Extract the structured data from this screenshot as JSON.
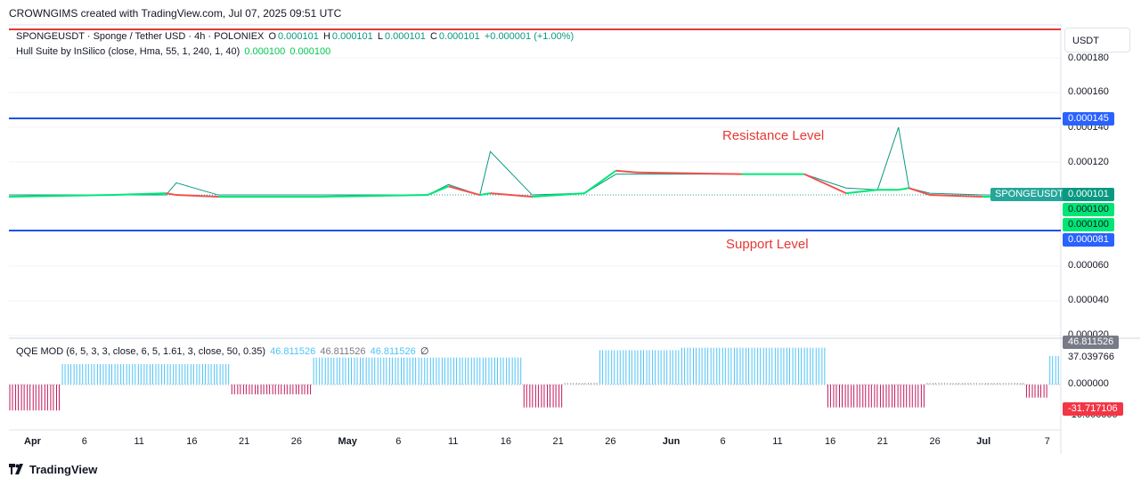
{
  "header": {
    "text": "CROWNGIMS created with TradingView.com, Jul 07, 2025 09:51 UTC"
  },
  "legend": {
    "symbol": "SPONGEUSDT · Sponge / Tether USD · 4h · POLONIEX",
    "o_label": "O",
    "o_value": "0.000101",
    "h_label": "H",
    "h_value": "0.000101",
    "l_label": "L",
    "l_value": "0.000101",
    "c_label": "C",
    "c_value": "0.000101",
    "change": "+0.000001 (+1.00%)",
    "hull_name": "Hull Suite by InSilico (close, Hma, 55, 1, 240, 1, 40)",
    "hull_v1": "0.000100",
    "hull_v2": "0.000100",
    "qqe_name": "QQE MOD (6, 5, 3, 3, close, 6, 5, 1.61, 3, close, 50, 0.35)",
    "qqe_v1": "46.811526",
    "qqe_v2": "46.811526",
    "qqe_v3": "46.811526",
    "qqe_v4": "∅"
  },
  "axis": {
    "unit": "USDT",
    "price_ticks": [
      "0.000180",
      "0.000160",
      "0.000140",
      "0.000120",
      "0.000060",
      "0.000040",
      "0.000020"
    ],
    "price_tick_values": [
      0.00018,
      0.00016,
      0.00014,
      0.00012,
      6e-05,
      4e-05,
      2e-05
    ],
    "qqe_ticks": [
      "37.039766",
      "0.000000",
      "-16.000000"
    ],
    "qqe_tick_values": [
      37.039766,
      0,
      -16
    ]
  },
  "tags": {
    "resistance": "0.000145",
    "last_price": "0.000101",
    "symbol_tag": "SPONGEUSDT",
    "hull_1": "0.000100",
    "hull_2": "0.000100",
    "support": "0.000081",
    "qqe_top": "46.811526",
    "qqe_bottom": "-31.717106"
  },
  "annotations": {
    "resistance": "Resistance Level",
    "support": "Support Level"
  },
  "x_axis": {
    "labels": [
      "Apr",
      "6",
      "11",
      "16",
      "21",
      "26",
      "May",
      "6",
      "11",
      "16",
      "21",
      "26",
      "Jun",
      "6",
      "11",
      "16",
      "21",
      "26",
      "Jul",
      "7"
    ],
    "day_index": [
      0,
      5,
      10,
      15,
      20,
      25,
      30,
      35,
      40,
      45,
      50,
      55,
      61,
      66,
      71,
      76,
      81,
      86,
      91,
      97
    ]
  },
  "footer": {
    "brand": "TradingView"
  },
  "colors": {
    "resistance_line": "#1e53e5",
    "support_line": "#1e53e5",
    "top_red": "#e53935",
    "hull_up": "#00e676",
    "hull_down": "#ef5350",
    "qqe_blue": "#4fc3f7",
    "qqe_magenta": "#c2185b",
    "qqe_grey": "#9e9e9e",
    "price_teal": "#089981"
  },
  "chart_data": [
    {
      "type": "line",
      "title": "SPONGEUSDT · Sponge / Tether USD · 4h · POLONIEX",
      "ylabel": "USDT",
      "ylim": [
        2e-05,
        0.00019
      ],
      "x": [
        0,
        10,
        15,
        16,
        20,
        30,
        40,
        42,
        45,
        46,
        50,
        55,
        58,
        60,
        70,
        76,
        80,
        83,
        85,
        86,
        88,
        93,
        94
      ],
      "series": [
        {
          "name": "SPONGEUSDT",
          "values": [
            0.000101,
            0.000101,
            0.000101,
            0.000108,
            0.000101,
            0.000101,
            0.000101,
            0.000107,
            0.000101,
            0.000126,
            0.000101,
            0.000102,
            0.000113,
            0.000113,
            0.000113,
            0.000113,
            0.000105,
            0.000104,
            0.00014,
            0.000105,
            0.000102,
            0.000101,
            0.000101
          ]
        },
        {
          "name": "Hull Suite",
          "values": [
            0.0001,
            0.000101,
            0.000102,
            0.000101,
            0.0001,
            0.0001,
            0.000101,
            0.000106,
            0.000101,
            0.000102,
            0.0001,
            0.000102,
            0.000115,
            0.000114,
            0.000113,
            0.000113,
            0.000102,
            0.000104,
            0.000104,
            0.000105,
            0.000101,
            0.0001,
            0.0001
          ]
        }
      ],
      "hlines": [
        {
          "name": "Resistance Level",
          "value": 0.000145
        },
        {
          "name": "Support Level",
          "value": 8.1e-05
        }
      ]
    },
    {
      "type": "bar",
      "title": "QQE MOD (6, 5, 3, 3, close, 6, 5, 1.61, 3, close, 50, 0.35)",
      "ylim": [
        -16,
        46.811526
      ],
      "segments": [
        {
          "from": 0,
          "to": 9,
          "value": -31.7,
          "color": "magenta"
        },
        {
          "from": 9,
          "to": 38,
          "value": 25,
          "color": "blue"
        },
        {
          "from": 38,
          "to": 52,
          "value": -12,
          "color": "magenta"
        },
        {
          "from": 52,
          "to": 88,
          "value": 33,
          "color": "blue"
        },
        {
          "from": 88,
          "to": 95,
          "value": -28,
          "color": "magenta"
        },
        {
          "from": 95,
          "to": 101,
          "value": 2,
          "color": "grey"
        },
        {
          "from": 101,
          "to": 115,
          "value": 42,
          "color": "blue"
        },
        {
          "from": 115,
          "to": 140,
          "value": 45,
          "color": "blue"
        },
        {
          "from": 140,
          "to": 157,
          "value": -28,
          "color": "magenta"
        },
        {
          "from": 157,
          "to": 169,
          "value": 2,
          "color": "grey"
        },
        {
          "from": 169,
          "to": 174,
          "value": 2,
          "color": "grey"
        },
        {
          "from": 174,
          "to": 178,
          "value": -16,
          "color": "magenta"
        },
        {
          "from": 178,
          "to": 180,
          "value": 35,
          "color": "blue"
        }
      ]
    }
  ]
}
